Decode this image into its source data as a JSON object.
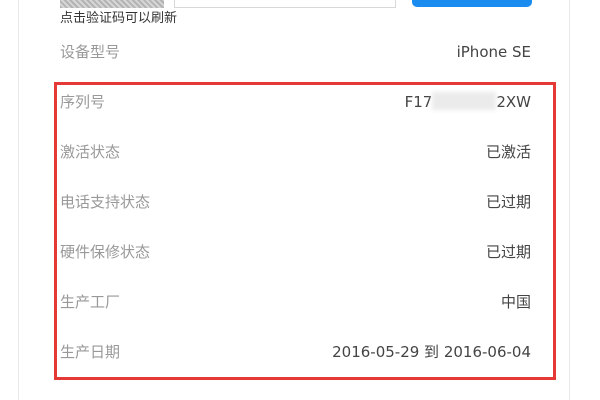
{
  "captcha": {
    "hint": "点击验证码可以刷新"
  },
  "device": {
    "model_label": "设备型号",
    "model_value": "iPhone SE"
  },
  "details": [
    {
      "label": "序列号",
      "value": ""
    },
    {
      "label": "激活状态",
      "value": "已激活"
    },
    {
      "label": "电话支持状态",
      "value": "已过期"
    },
    {
      "label": "硬件保修状态",
      "value": "已过期"
    },
    {
      "label": "生产工厂",
      "value": "中国"
    },
    {
      "label": "生产日期",
      "value": "2016-05-29 到 2016-06-04"
    }
  ],
  "serial": {
    "prefix": "F17",
    "suffix": "2XW"
  },
  "colors": {
    "highlight": "#e53935",
    "button": "#1a8cf0",
    "label": "#999999",
    "value": "#444444"
  }
}
